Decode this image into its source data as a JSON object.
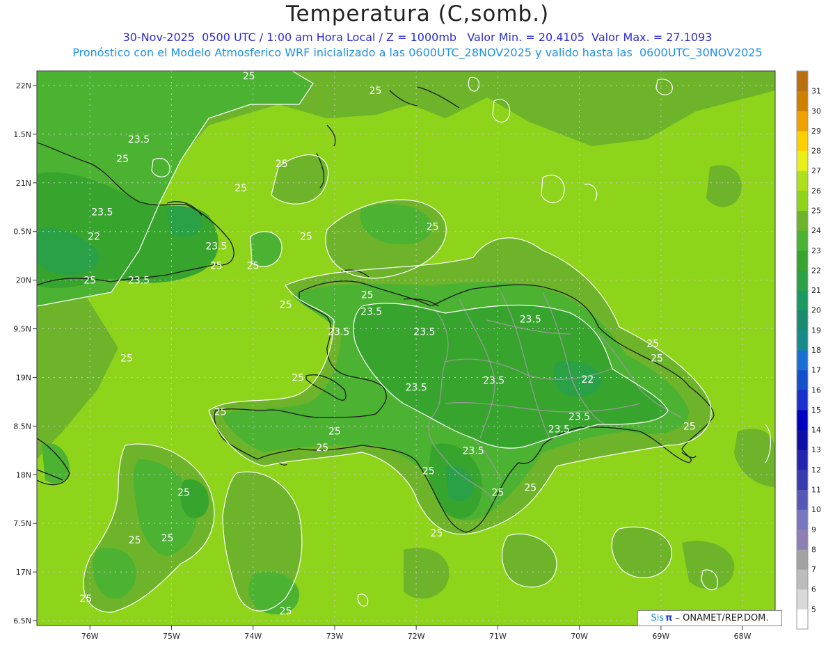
{
  "title": "Temperatura (C,somb.)",
  "subtitle1": "30-Nov-2025  0500 UTC / 1:00 am Hora Local / Z = 1000mb   Valor Min. = 20.4105  Valor Max. = 27.1093",
  "subtitle2": "Pronóstico con el Modelo Atmosferico WRF inicializado a las 0600UTC_28NOV2025 y valido hasta las  0600UTC_30NOV2025",
  "credit": {
    "logo": "Sis",
    "pi": "π",
    "rest": "– ONAMET/REP.DOM."
  },
  "colors": {
    "c23": "#37a52d",
    "c24": "#4cb232",
    "c25": "#6db42a",
    "c26": "#8ed41b",
    "border": "#1a1a1a",
    "provinces": "#9a9a9a",
    "contour": "#ffffff"
  },
  "chart_data": {
    "type": "heatmap",
    "x_ticks": [
      "76W",
      "75W",
      "74W",
      "73W",
      "72W",
      "71W",
      "70W",
      "69W",
      "68W"
    ],
    "y_ticks": [
      "22N",
      "1.5N",
      "21N",
      "0.5N",
      "20N",
      "9.5N",
      "19N",
      "8.5N",
      "18N",
      "7.5N",
      "17N",
      "6.5N"
    ],
    "xlim": [
      -76.65,
      -67.6
    ],
    "ylim": [
      16.45,
      22.15
    ],
    "grid": true,
    "colorbar": {
      "levels": [
        "5",
        "6",
        "7",
        "8",
        "9",
        "10",
        "11",
        "12",
        "13",
        "14",
        "15",
        "16",
        "17",
        "18",
        "19",
        "20",
        "21",
        "22",
        "23",
        "24",
        "25",
        "26",
        "27",
        "28",
        "29",
        "30",
        "31"
      ],
      "colors": [
        "#ffffff",
        "#d9d9d9",
        "#bcbcbc",
        "#a2a2a2",
        "#8f7fb5",
        "#7777c0",
        "#5757b8",
        "#3b3bb0",
        "#2424b0",
        "#0f0fa8",
        "#0000c4",
        "#1a30cc",
        "#1450cc",
        "#1870d4",
        "#198a8a",
        "#1a8a70",
        "#1a9a60",
        "#2aa047",
        "#37a52d",
        "#4cb232",
        "#6db42a",
        "#8ed41b",
        "#b0e01c",
        "#e8f018",
        "#ffd000",
        "#f0a000",
        "#d08000",
        "#b87010"
      ]
    },
    "contour_labels": [
      {
        "text": "25",
        "lon": -74.05,
        "lat": 22.1
      },
      {
        "text": "25",
        "lon": -72.5,
        "lat": 21.95
      },
      {
        "text": "23.5",
        "lon": -75.4,
        "lat": 21.45
      },
      {
        "text": "25",
        "lon": -75.6,
        "lat": 21.25
      },
      {
        "text": "25",
        "lon": -73.65,
        "lat": 21.2
      },
      {
        "text": "25",
        "lon": -74.15,
        "lat": 20.95
      },
      {
        "text": "23.5",
        "lon": -75.85,
        "lat": 20.7
      },
      {
        "text": "25",
        "lon": -71.8,
        "lat": 20.55
      },
      {
        "text": "22",
        "lon": -75.95,
        "lat": 20.45
      },
      {
        "text": "25",
        "lon": -73.35,
        "lat": 20.45
      },
      {
        "text": "23.5",
        "lon": -74.45,
        "lat": 20.35
      },
      {
        "text": "25",
        "lon": -74.45,
        "lat": 20.15
      },
      {
        "text": "25",
        "lon": -74.0,
        "lat": 20.15
      },
      {
        "text": "25",
        "lon": -76.0,
        "lat": 20.0
      },
      {
        "text": "23.5",
        "lon": -75.4,
        "lat": 20.0
      },
      {
        "text": "25",
        "lon": -72.6,
        "lat": 19.85
      },
      {
        "text": "25",
        "lon": -73.6,
        "lat": 19.75
      },
      {
        "text": "23.5",
        "lon": -72.55,
        "lat": 19.68
      },
      {
        "text": "23.5",
        "lon": -72.95,
        "lat": 19.47
      },
      {
        "text": "23.5",
        "lon": -71.9,
        "lat": 19.47
      },
      {
        "text": "23.5",
        "lon": -70.6,
        "lat": 19.6
      },
      {
        "text": "25",
        "lon": -69.1,
        "lat": 19.35
      },
      {
        "text": "25",
        "lon": -69.05,
        "lat": 19.2
      },
      {
        "text": "25",
        "lon": -75.55,
        "lat": 19.2
      },
      {
        "text": "25",
        "lon": -73.45,
        "lat": 19.0
      },
      {
        "text": "23.5",
        "lon": -71.05,
        "lat": 18.97
      },
      {
        "text": "22",
        "lon": -69.9,
        "lat": 18.98
      },
      {
        "text": "23.5",
        "lon": -72.0,
        "lat": 18.9
      },
      {
        "text": "25",
        "lon": -74.4,
        "lat": 18.65
      },
      {
        "text": "23.5",
        "lon": -70.0,
        "lat": 18.6
      },
      {
        "text": "23.5",
        "lon": -70.25,
        "lat": 18.47
      },
      {
        "text": "25",
        "lon": -68.65,
        "lat": 18.5
      },
      {
        "text": "25",
        "lon": -73.0,
        "lat": 18.45
      },
      {
        "text": "25",
        "lon": -73.15,
        "lat": 18.28
      },
      {
        "text": "23.5",
        "lon": -71.3,
        "lat": 18.25
      },
      {
        "text": "25",
        "lon": -71.85,
        "lat": 18.04
      },
      {
        "text": "25",
        "lon": -74.85,
        "lat": 17.82
      },
      {
        "text": "25",
        "lon": -71.0,
        "lat": 17.82
      },
      {
        "text": "25",
        "lon": -70.6,
        "lat": 17.87
      },
      {
        "text": "25",
        "lon": -75.45,
        "lat": 17.33
      },
      {
        "text": "25",
        "lon": -75.05,
        "lat": 17.35
      },
      {
        "text": "25",
        "lon": -71.75,
        "lat": 17.4
      },
      {
        "text": "25",
        "lon": -76.05,
        "lat": 16.73
      },
      {
        "text": "25",
        "lon": -73.6,
        "lat": 16.6
      }
    ]
  }
}
